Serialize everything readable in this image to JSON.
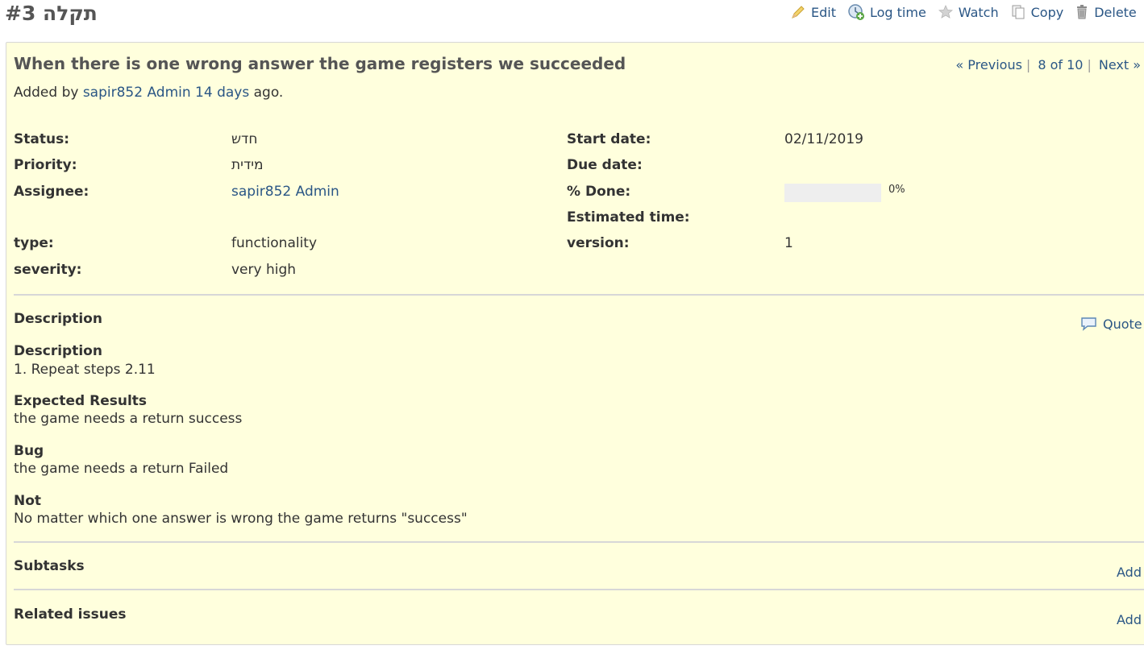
{
  "page": {
    "title": "תקלה #3"
  },
  "toolbar": {
    "edit": "Edit",
    "log_time": "Log time",
    "watch": "Watch",
    "copy": "Copy",
    "delete": "Delete"
  },
  "issue": {
    "subject": "When there is one wrong answer the game registers we succeeded",
    "nav": {
      "previous": "« Previous",
      "position": "8 of 10",
      "next": "Next »"
    },
    "author": {
      "prefix": "Added by",
      "name": "sapir852 Admin",
      "age": "14 days",
      "suffix": "ago."
    },
    "attributes": {
      "status": {
        "label": "Status:",
        "value": "חדש"
      },
      "priority": {
        "label": "Priority:",
        "value": "מידית"
      },
      "assignee": {
        "label": "Assignee:",
        "value": "sapir852 Admin"
      },
      "type": {
        "label": "type:",
        "value": "functionality"
      },
      "severity": {
        "label": "severity:",
        "value": "very high"
      },
      "start_date": {
        "label": "Start date:",
        "value": "02/11/2019"
      },
      "due_date": {
        "label": "Due date:",
        "value": ""
      },
      "done": {
        "label": "% Done:",
        "value": "0%",
        "fraction": 0
      },
      "estimated_time": {
        "label": "Estimated time:",
        "value": ""
      },
      "version": {
        "label": "version:",
        "value": "1"
      }
    },
    "description": {
      "section_title": "Description",
      "quote_label": "Quote",
      "blocks": [
        {
          "heading": "Description",
          "text": "1. Repeat steps 2.11"
        },
        {
          "heading": "Expected Results",
          "text": "the game needs a return success"
        },
        {
          "heading": "Bug",
          "text": "the game needs a return Failed"
        },
        {
          "heading": "Not",
          "text": "No matter which one answer is wrong the game returns \"success\""
        }
      ]
    },
    "subtasks": {
      "title": "Subtasks",
      "add_label": "Add"
    },
    "relations": {
      "title": "Related issues",
      "add_label": "Add"
    }
  },
  "colors": {
    "link": "#2a5685",
    "box_background": "#ffffdd",
    "box_border": "#d7d7d7",
    "progress_empty": "#eeeeee"
  }
}
